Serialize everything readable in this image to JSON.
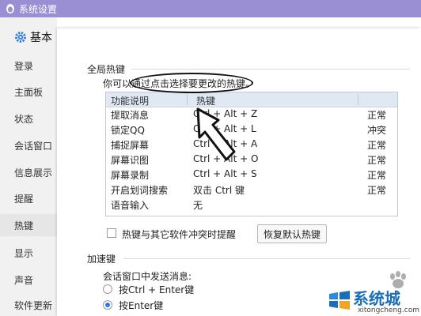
{
  "window": {
    "title": "系统设置"
  },
  "sidebar": {
    "header": "基本",
    "items": [
      {
        "label": "登录"
      },
      {
        "label": "主面板"
      },
      {
        "label": "状态"
      },
      {
        "label": "会话窗口"
      },
      {
        "label": "信息展示"
      },
      {
        "label": "提醒"
      },
      {
        "label": "热键",
        "active": true
      },
      {
        "label": "显示"
      },
      {
        "label": "声音"
      },
      {
        "label": "软件更新"
      }
    ]
  },
  "global_hotkeys": {
    "section_title": "全局热键",
    "hint": "你可以通过点击选择要更改的热键。",
    "columns": [
      "功能说明",
      "热键"
    ],
    "rows": [
      {
        "function": "提取消息",
        "hotkey": "Ctrl + Alt + Z",
        "status": "正常"
      },
      {
        "function": "锁定QQ",
        "hotkey": "Ctrl + Alt + L",
        "status": "冲突"
      },
      {
        "function": "捕捉屏幕",
        "hotkey": "Ctrl + Alt + A",
        "status": "正常"
      },
      {
        "function": "屏幕识图",
        "hotkey": "Ctrl + Alt + O",
        "status": "正常"
      },
      {
        "function": "屏幕录制",
        "hotkey": "Ctrl + Alt + S",
        "status": "正常"
      },
      {
        "function": "开启划词搜索",
        "hotkey": "双击 Ctrl 键",
        "status": "正常"
      },
      {
        "function": "语音输入",
        "hotkey": "无",
        "status": ""
      }
    ],
    "conflict_checkbox_label": "热键与其它软件冲突时提醒",
    "restore_button": "恢复默认热键"
  },
  "accelerator": {
    "section_title": "加速键",
    "send_label": "会话窗口中发送消息:",
    "options": [
      {
        "label": "按Ctrl + Enter键",
        "checked": false
      },
      {
        "label": "按Enter键",
        "checked": true
      }
    ]
  },
  "watermark": {
    "brand": "系统城",
    "url": "xitongcheng.com"
  },
  "colors": {
    "titlebar": "#9b8fd4",
    "table_header": "#dfe8f3",
    "logo_blue": "#1a6fb8"
  }
}
